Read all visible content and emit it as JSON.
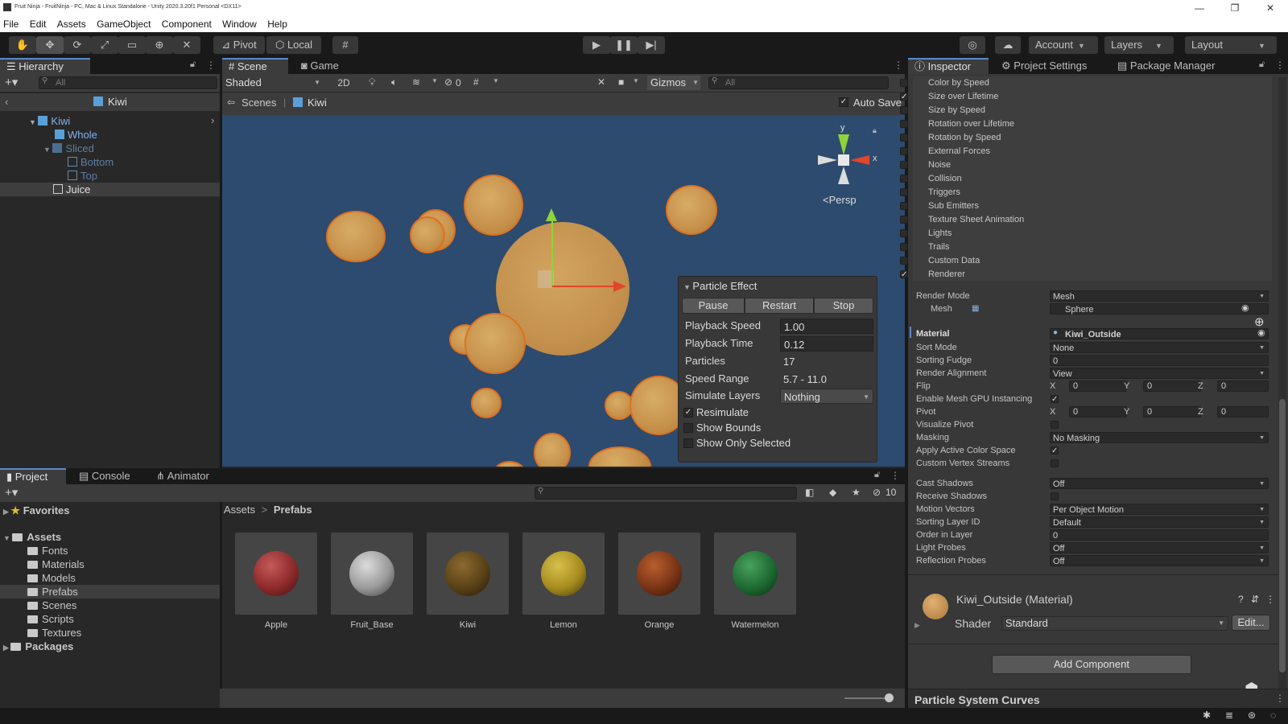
{
  "window": {
    "title": "Fruit Ninja - FruitNinja - PC, Mac & Linux Standalone - Unity 2020.3.20f1 Personal <DX11>"
  },
  "menu": [
    "File",
    "Edit",
    "Assets",
    "GameObject",
    "Component",
    "Window",
    "Help"
  ],
  "toolbar": {
    "pivot": "Pivot",
    "local": "Local",
    "account": "Account",
    "layers": "Layers",
    "layout": "Layout"
  },
  "hierarchy": {
    "tab": "Hierarchy",
    "search_placeholder": "All",
    "scene": "Kiwi",
    "items": [
      {
        "label": "Kiwi",
        "state": "prefab"
      },
      {
        "label": "Whole",
        "state": "prefab"
      },
      {
        "label": "Sliced",
        "state": "disabled"
      },
      {
        "label": "Bottom",
        "state": "disabled"
      },
      {
        "label": "Top",
        "state": "disabled"
      },
      {
        "label": "Juice",
        "state": "selected"
      }
    ]
  },
  "scene": {
    "tabs": [
      "Scene",
      "Game"
    ],
    "shading": "Shaded",
    "mode2d": "2D",
    "hidden_count": "0",
    "gizmos": "Gizmos",
    "search_placeholder": "All",
    "breadcrumb": [
      "Scenes",
      "Kiwi"
    ],
    "auto_save": "Auto Save",
    "persp": "Persp",
    "gizmo_axes": [
      "y",
      "x"
    ]
  },
  "particle_effect": {
    "title": "Particle Effect",
    "buttons": [
      "Pause",
      "Restart",
      "Stop"
    ],
    "playback_speed_label": "Playback Speed",
    "playback_speed": "1.00",
    "playback_time_label": "Playback Time",
    "playback_time": "0.12",
    "particles_label": "Particles",
    "particles": "17",
    "speed_range_label": "Speed Range",
    "speed_range": "5.7 - 11.0",
    "simulate_layers_label": "Simulate Layers",
    "simulate_layers": "Nothing",
    "resimulate": "Resimulate",
    "show_bounds": "Show Bounds",
    "show_only_selected": "Show Only Selected",
    "resimulate_checked": true,
    "show_bounds_checked": false,
    "show_only_selected_checked": false
  },
  "inspector": {
    "tabs": [
      "Inspector",
      "Project Settings",
      "Package Manager"
    ],
    "modules": [
      {
        "label": "Color by Speed",
        "checked": false
      },
      {
        "label": "Size over Lifetime",
        "checked": true
      },
      {
        "label": "Size by Speed",
        "checked": false
      },
      {
        "label": "Rotation over Lifetime",
        "checked": false
      },
      {
        "label": "Rotation by Speed",
        "checked": false
      },
      {
        "label": "External Forces",
        "checked": false
      },
      {
        "label": "Noise",
        "checked": false
      },
      {
        "label": "Collision",
        "checked": false
      },
      {
        "label": "Triggers",
        "checked": false
      },
      {
        "label": "Sub Emitters",
        "checked": false
      },
      {
        "label": "Texture Sheet Animation",
        "checked": false
      },
      {
        "label": "Lights",
        "checked": false
      },
      {
        "label": "Trails",
        "checked": false
      },
      {
        "label": "Custom Data",
        "checked": false
      },
      {
        "label": "Renderer",
        "checked": true
      }
    ],
    "render_mode": {
      "label": "Render Mode",
      "value": "Mesh"
    },
    "mesh": {
      "label": "Mesh",
      "value": "Sphere"
    },
    "material": {
      "label": "Material",
      "value": "Kiwi_Outside"
    },
    "sort_mode": {
      "label": "Sort Mode",
      "value": "None"
    },
    "sorting_fudge": {
      "label": "Sorting Fudge",
      "value": "0"
    },
    "render_alignment": {
      "label": "Render Alignment",
      "value": "View"
    },
    "flip": {
      "label": "Flip",
      "x": "0",
      "y": "0",
      "z": "0"
    },
    "gpu_instancing": {
      "label": "Enable Mesh GPU Instancing",
      "checked": true
    },
    "pivot": {
      "label": "Pivot",
      "x": "0",
      "y": "0",
      "z": "0"
    },
    "visualize_pivot": {
      "label": "Visualize Pivot",
      "checked": false
    },
    "masking": {
      "label": "Masking",
      "value": "No Masking"
    },
    "apply_active_color_space": {
      "label": "Apply Active Color Space",
      "checked": true
    },
    "custom_vertex_streams": {
      "label": "Custom Vertex Streams",
      "checked": false
    },
    "cast_shadows": {
      "label": "Cast Shadows",
      "value": "Off"
    },
    "receive_shadows": {
      "label": "Receive Shadows",
      "checked": false
    },
    "motion_vectors": {
      "label": "Motion Vectors",
      "value": "Per Object Motion"
    },
    "sorting_layer_id": {
      "label": "Sorting Layer ID",
      "value": "Default"
    },
    "order_in_layer": {
      "label": "Order in Layer",
      "value": "0"
    },
    "light_probes": {
      "label": "Light Probes",
      "value": "Off"
    },
    "reflection_probes": {
      "label": "Reflection Probes",
      "value": "Off"
    },
    "material_header": "Kiwi_Outside (Material)",
    "shader_label": "Shader",
    "shader": "Standard",
    "edit": "Edit...",
    "add_component": "Add Component",
    "curves": "Particle System Curves",
    "axis_labels": {
      "x": "X",
      "y": "Y",
      "z": "Z"
    }
  },
  "project": {
    "tabs": [
      "Project",
      "Console",
      "Animator"
    ],
    "hidden_count": "10",
    "breadcrumb": [
      "Assets",
      "Prefabs"
    ],
    "favorites": "Favorites",
    "assets_root": "Assets",
    "folders": [
      "Fonts",
      "Materials",
      "Models",
      "Prefabs",
      "Scenes",
      "Scripts",
      "Textures"
    ],
    "selected_folder": "Prefabs",
    "packages": "Packages",
    "prefabs": [
      {
        "name": "Apple",
        "color": "#8e2a2a"
      },
      {
        "name": "Fruit_Base",
        "color": "#9a9a9a"
      },
      {
        "name": "Kiwi",
        "color": "#5a4216"
      },
      {
        "name": "Lemon",
        "color": "#a68c1e"
      },
      {
        "name": "Orange",
        "color": "#7a3416"
      },
      {
        "name": "Watermelon",
        "color": "#1e6a32"
      }
    ]
  },
  "colors": {
    "accent": "#5b88c9",
    "fruit": "#c8944e",
    "fruit_outline": "#e0701e",
    "scene_bg": "#2d4b6e"
  }
}
